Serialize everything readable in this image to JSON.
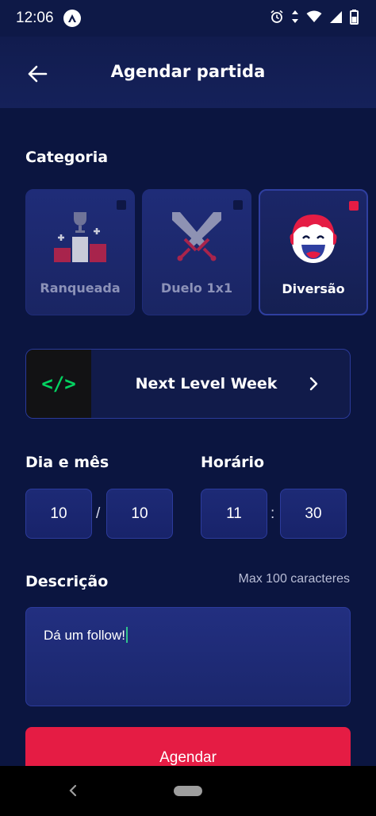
{
  "status_bar": {
    "time": "12:06",
    "icons": [
      "app-notification-icon",
      "alarm-icon",
      "data-arrows-icon",
      "wifi-icon",
      "signal-icon",
      "battery-icon"
    ]
  },
  "header": {
    "title": "Agendar partida",
    "back_icon": "arrow-left-icon"
  },
  "category": {
    "label": "Categoria",
    "items": [
      {
        "label": "Ranqueada",
        "icon": "ranked-trophy-icon",
        "selected": false
      },
      {
        "label": "Duelo 1x1",
        "icon": "crossed-swords-icon",
        "selected": false
      },
      {
        "label": "Diversão",
        "icon": "laughing-face-icon",
        "selected": true
      }
    ]
  },
  "server": {
    "thumb_text": "</>",
    "name": "Next Level Week",
    "chevron_icon": "chevron-right-icon"
  },
  "date": {
    "label": "Dia e mês",
    "day": "10",
    "month": "10",
    "separator": "/"
  },
  "time": {
    "label": "Horário",
    "hour": "11",
    "minute": "30",
    "separator": ":"
  },
  "description": {
    "label": "Descrição",
    "limit_text": "Max 100 caracteres",
    "value": "Dá um follow!"
  },
  "submit": {
    "label": "Agendar"
  },
  "colors": {
    "background": "#0b1540",
    "accent": "#e51c44",
    "border": "#2c3b9c",
    "server_icon": "#04d361"
  }
}
